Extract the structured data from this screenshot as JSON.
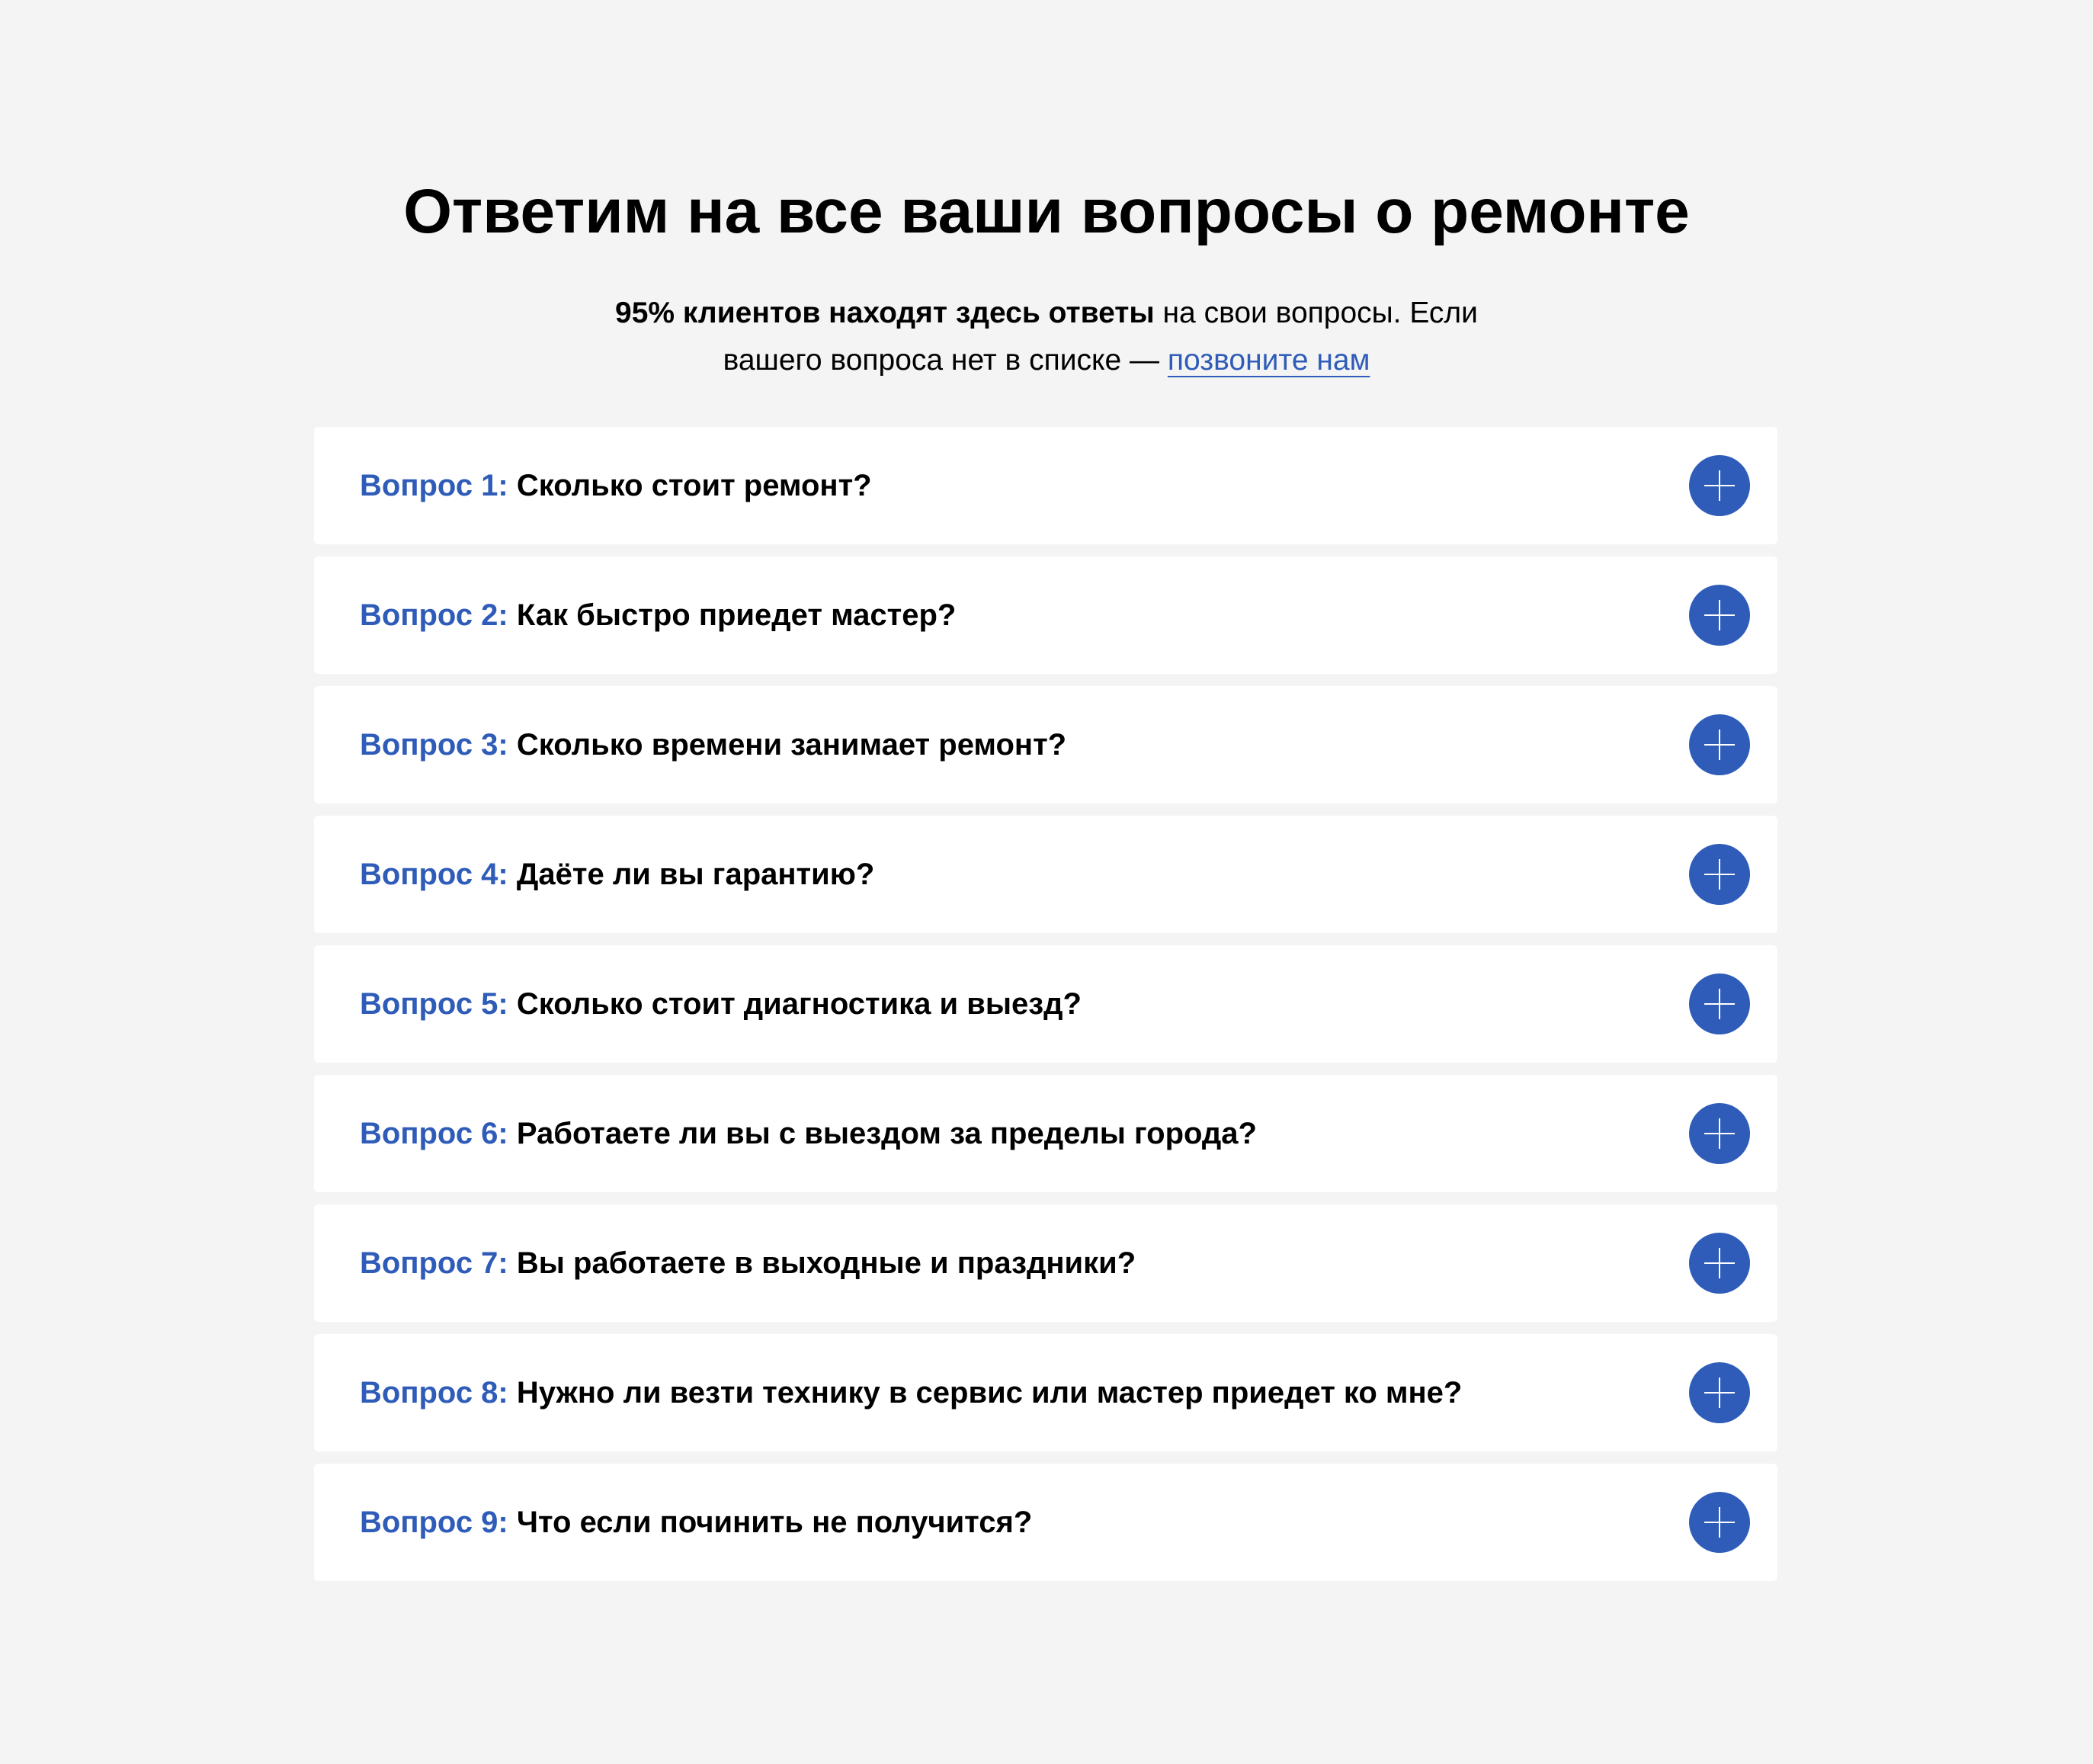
{
  "header": {
    "title": "Ответим на все ваши вопросы о ремонте",
    "subtitle_bold": "95% клиентов находят здесь ответы",
    "subtitle_rest_line1": " на свои вопросы. Если",
    "subtitle_line2": "вашего вопроса нет в списке — ",
    "call_link": "позвоните нам"
  },
  "colors": {
    "background": "#f4f4f4",
    "card": "#ffffff",
    "accent": "#2f5cb8",
    "text": "#000000"
  },
  "faq": {
    "toggle_icon": "plus-icon",
    "items": [
      {
        "prefix": "Вопрос 1:",
        "question": "Сколько стоит ремонт?"
      },
      {
        "prefix": "Вопрос 2:",
        "question": "Как быстро приедет мастер?"
      },
      {
        "prefix": "Вопрос 3:",
        "question": "Сколько времени занимает ремонт?"
      },
      {
        "prefix": "Вопрос 4:",
        "question": "Даёте ли вы гарантию?"
      },
      {
        "prefix": "Вопрос 5:",
        "question": "Сколько стоит диагностика и выезд?"
      },
      {
        "prefix": "Вопрос 6:",
        "question": "Работаете ли вы с выездом за пределы города?"
      },
      {
        "prefix": "Вопрос 7:",
        "question": "Вы работаете в выходные и праздники?"
      },
      {
        "prefix": "Вопрос 8:",
        "question": "Нужно ли везти технику в сервис или мастер приедет ко мне?"
      },
      {
        "prefix": "Вопрос 9:",
        "question": "Что если починить не получится?"
      }
    ]
  }
}
